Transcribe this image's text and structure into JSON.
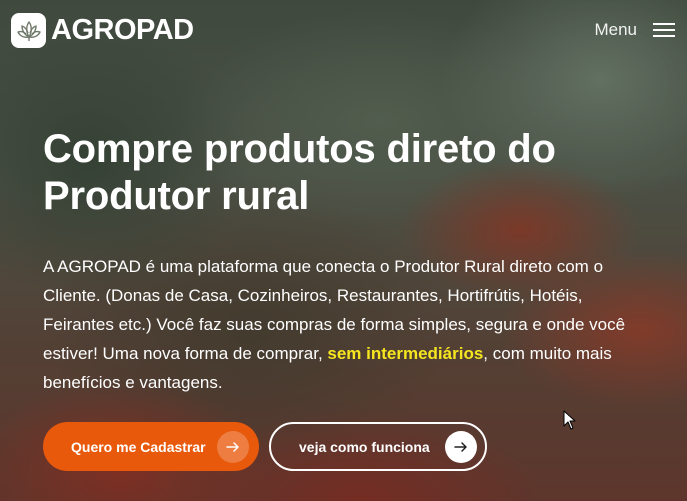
{
  "header": {
    "logo_text": "AGROPAD",
    "logo_icon": "lotus-flower-icon",
    "menu_label": "Menu",
    "menu_icon": "hamburger-icon"
  },
  "hero": {
    "title_line1": "Compre produtos direto do",
    "title_line2": "Produtor rural",
    "description_before": "A AGROPAD é uma plataforma que conecta o Produtor Rural direto com o Cliente. (Donas de Casa, Cozinheiros, Restaurantes, Hortifrútis, Hotéis, Feirantes etc.) Você faz suas compras de forma simples, segura e onde você estiver! Uma nova forma de comprar, ",
    "description_highlight": "sem intermediários",
    "description_after": ", com muito mais benefícios e vantagens.",
    "primary_button": {
      "label": "Quero me Cadastrar",
      "icon": "arrow-right-icon"
    },
    "secondary_button": {
      "label": "veja como funciona",
      "icon": "arrow-right-icon"
    }
  },
  "colors": {
    "accent_orange": "#e8590c",
    "highlight_yellow": "#f5e61f",
    "text_white": "#ffffff"
  }
}
